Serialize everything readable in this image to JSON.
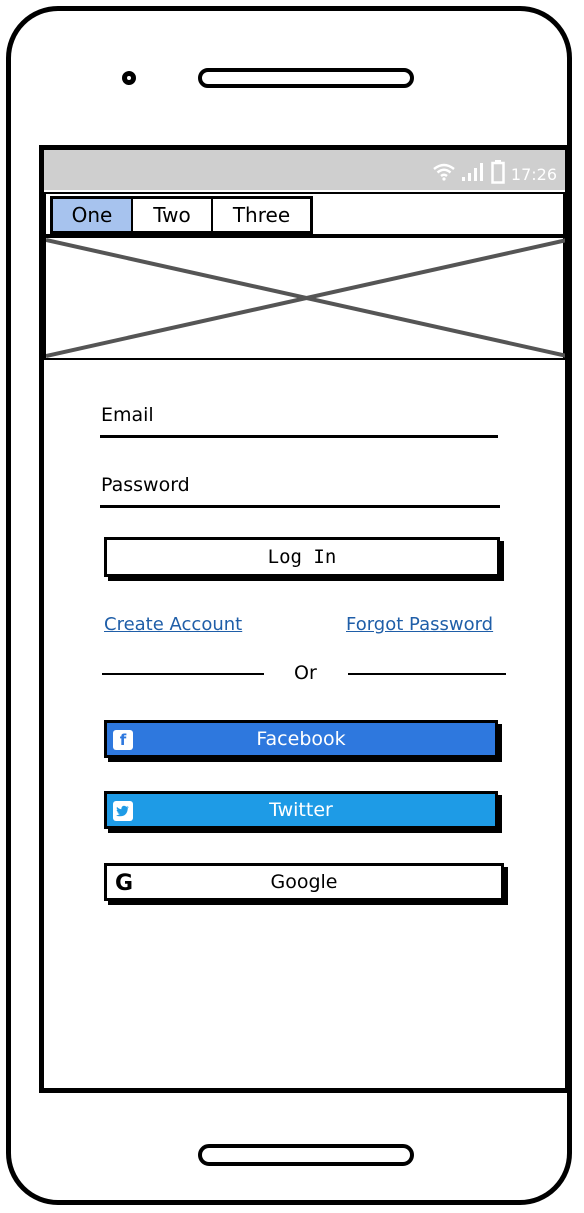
{
  "status_bar": {
    "time": "17:26",
    "wifi_icon": "wifi-icon",
    "signal_icon": "signal-icon",
    "battery_icon": "battery-icon"
  },
  "tabs": [
    {
      "label": "One",
      "active": true
    },
    {
      "label": "Two",
      "active": false
    },
    {
      "label": "Three",
      "active": false
    }
  ],
  "form": {
    "email_label": "Email",
    "password_label": "Password",
    "login_label": "Log In"
  },
  "links": {
    "create_account": "Create Account",
    "forgot_password": "Forgot Password"
  },
  "divider": {
    "text": "Or"
  },
  "social": {
    "facebook": {
      "label": "Facebook",
      "icon": "facebook-icon",
      "color": "#2e78de"
    },
    "twitter": {
      "label": "Twitter",
      "icon": "twitter-icon",
      "color": "#1e9be6"
    },
    "google": {
      "label": "Google",
      "icon": "google-icon",
      "color": "#ffffff"
    }
  },
  "colors": {
    "active_tab": "#a7c3ee",
    "status_bar": "#cfcfcf",
    "link": "#1f5ea8"
  }
}
